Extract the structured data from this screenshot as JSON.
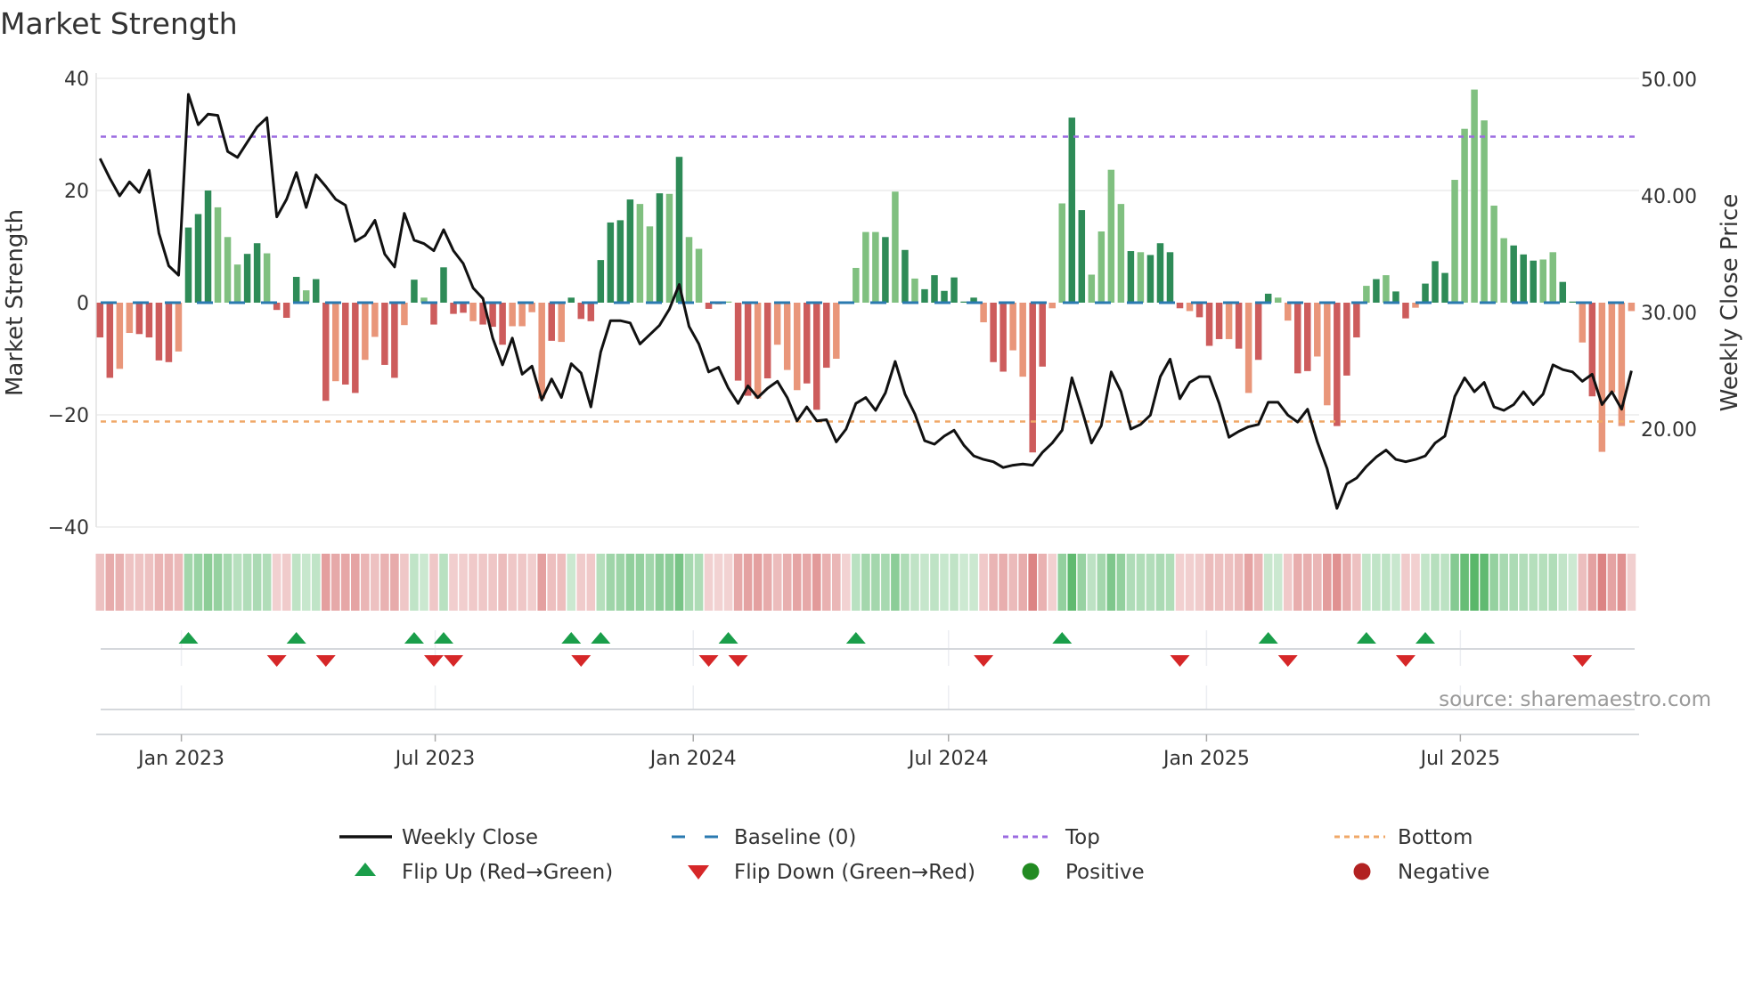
{
  "chart_data": {
    "type": "bar+line",
    "title": "Market Strength",
    "ylabel_left": "Market Strength",
    "ylabel_right": "Weekly Close Price",
    "ylim_left": [
      -40,
      40
    ],
    "ylim_right": [
      11.7,
      50
    ],
    "left_ticks": [
      {
        "value": 40,
        "label": "40"
      },
      {
        "value": 20,
        "label": "20"
      },
      {
        "value": 0,
        "label": "0"
      },
      {
        "value": -20,
        "label": "−20"
      },
      {
        "value": -40,
        "label": "−40"
      }
    ],
    "right_ticks": [
      {
        "value": 50,
        "label": "50.00"
      },
      {
        "value": 40,
        "label": "40.00"
      },
      {
        "value": 30,
        "label": "30.00"
      },
      {
        "value": 20,
        "label": "20.00"
      }
    ],
    "x_ticks": [
      {
        "date": "2023-01-01",
        "label": "Jan 2023"
      },
      {
        "date": "2023-07-01",
        "label": "Jul 2023"
      },
      {
        "date": "2024-01-01",
        "label": "Jan 2024"
      },
      {
        "date": "2024-07-01",
        "label": "Jul 2024"
      },
      {
        "date": "2025-01-01",
        "label": "Jan 2025"
      },
      {
        "date": "2025-07-01",
        "label": "Jul 2025"
      }
    ],
    "x_start_date": "2022-11-04",
    "x_interval_days": 7,
    "top_level": 29.6,
    "bottom_level": -21.2,
    "baseline": 0,
    "strength": [
      -6.2,
      -13.4,
      -11.8,
      -5.4,
      -5.6,
      -6.2,
      -10.3,
      -10.6,
      -8.7,
      13.4,
      15.8,
      20,
      17,
      11.7,
      6.8,
      8.7,
      10.6,
      8.8,
      -1.3,
      -2.7,
      4.6,
      2.2,
      4.2,
      -17.5,
      -14,
      -14.6,
      -16.1,
      -10.2,
      -6.1,
      -11.1,
      -13.4,
      -4,
      4.1,
      0.9,
      -3.9,
      6.3,
      -2,
      -1.8,
      -3.3,
      -3.9,
      -4.3,
      -7.5,
      -4.2,
      -4.2,
      -1.7,
      -17.1,
      -6.8,
      -7,
      0.9,
      -2.9,
      -3.3,
      7.6,
      14.3,
      14.7,
      18.4,
      17.6,
      13.6,
      19.5,
      19.4,
      26,
      11.7,
      9.6,
      -1.1,
      -0.3,
      0.2,
      -13.9,
      -16.6,
      -17.1,
      -13.5,
      -7.5,
      -12,
      -15.6,
      -14.4,
      -19.1,
      -11.6,
      -10,
      -0.2,
      6.2,
      12.6,
      12.6,
      11.7,
      19.8,
      9.4,
      4.3,
      2.4,
      4.9,
      2.1,
      4.5,
      0.2,
      0.9,
      -3.5,
      -10.6,
      -12.3,
      -8.5,
      -13.2,
      -26.7,
      -11.4,
      -1,
      17.7,
      33,
      16.5,
      5,
      12.7,
      23.7,
      17.6,
      9.2,
      9,
      8.5,
      10.6,
      9,
      -1,
      -1.5,
      -2.6,
      -7.7,
      -6.5,
      -6.5,
      -8.2,
      -16.1,
      -10.2,
      1.6,
      0.9,
      -3.2,
      -12.6,
      -12.2,
      -9.6,
      -18.3,
      -22,
      -13,
      -6.2,
      3,
      4.2,
      4.9,
      2,
      -2.8,
      -0.9,
      3.4,
      7.4,
      5.3,
      21.9,
      31,
      38,
      32.5,
      17.3,
      11.5,
      10.2,
      8.6,
      7.5,
      7.7,
      9,
      3.7,
      0.2,
      -7.1,
      -16.7,
      -26.6,
      -16,
      -22,
      -1.5
    ],
    "strength_shade": "ddllddddldddlllddldddlddlddllddldlddddldddlllldldddddddlldldlldllddldllldddldllldldlddddddlddllddllddlllldlddddldddldlddllddlldddldlddldddlllllldddllddldl",
    "weekly_close": [
      43.2,
      41.5,
      40.0,
      41.2,
      40.3,
      42.2,
      36.8,
      34.0,
      33.2,
      48.7,
      46.1,
      47.0,
      46.9,
      43.8,
      43.3,
      44.6,
      45.9,
      46.7,
      38.2,
      39.7,
      42.0,
      39.0,
      41.8,
      40.8,
      39.7,
      39.2,
      36.1,
      36.6,
      37.9,
      35.0,
      33.9,
      38.5,
      36.2,
      35.9,
      35.3,
      37.1,
      35.3,
      34.2,
      32.1,
      31.2,
      27.8,
      25.5,
      27.8,
      24.7,
      25.4,
      22.5,
      24.3,
      22.7,
      25.6,
      24.8,
      21.9,
      26.6,
      29.3,
      29.3,
      29.1,
      27.3,
      28.1,
      28.9,
      30.3,
      32.4,
      28.8,
      27.3,
      24.9,
      25.3,
      23.5,
      22.2,
      23.7,
      22.7,
      23.5,
      24.1,
      22.7,
      20.7,
      21.9,
      20.7,
      20.8,
      18.9,
      20.0,
      22.2,
      22.7,
      21.6,
      23.1,
      25.8,
      23.0,
      21.3,
      19.0,
      18.7,
      19.4,
      19.9,
      18.6,
      17.7,
      17.4,
      17.2,
      16.7,
      16.9,
      17.0,
      16.9,
      18.0,
      18.8,
      19.9,
      24.4,
      21.7,
      18.8,
      20.3,
      24.9,
      23.2,
      20.0,
      20.4,
      21.2,
      24.5,
      26.0,
      22.6,
      24.0,
      24.5,
      24.5,
      22.2,
      19.3,
      19.8,
      20.2,
      20.4,
      22.3,
      22.3,
      21.2,
      20.6,
      21.7,
      18.9,
      16.6,
      13.2,
      15.3,
      15.8,
      16.8,
      17.6,
      18.2,
      17.4,
      17.2,
      17.4,
      17.7,
      18.8,
      19.4,
      22.8,
      24.4,
      23.2,
      24.0,
      21.9,
      21.6,
      22.1,
      23.2,
      22.1,
      23.0,
      25.5,
      25.1,
      24.9,
      24.1,
      24.7,
      22.1,
      23.2,
      21.7,
      25.0
    ],
    "flip_up_weeks": [
      10,
      21,
      33,
      36,
      49,
      52,
      65,
      78,
      99,
      120,
      130,
      136
    ],
    "flip_down_weeks": [
      19,
      24,
      35,
      37,
      50,
      63,
      66,
      91,
      111,
      122,
      134,
      152
    ],
    "legend": {
      "weekly_close": "Weekly Close",
      "baseline": "Baseline (0)",
      "top": "Top",
      "bottom": "Bottom",
      "flip_up": "Flip Up (Red→Green)",
      "flip_down": "Flip Down (Green→Red)",
      "positive": "Positive",
      "negative": "Negative"
    },
    "source": "source: sharemaestro.com",
    "colors": {
      "dark_green": "#2e8b57",
      "light_green": "#80c080",
      "dark_red": "#cd5c5c",
      "light_red": "#e9967a",
      "baseline": "#2a7ab0",
      "top": "#9b6be0",
      "bottom": "#f0a868",
      "line": "#111111",
      "flip_up": "#1a9e4a",
      "flip_down": "#d62728",
      "positive": "#228b22",
      "negative": "#b22222"
    }
  }
}
